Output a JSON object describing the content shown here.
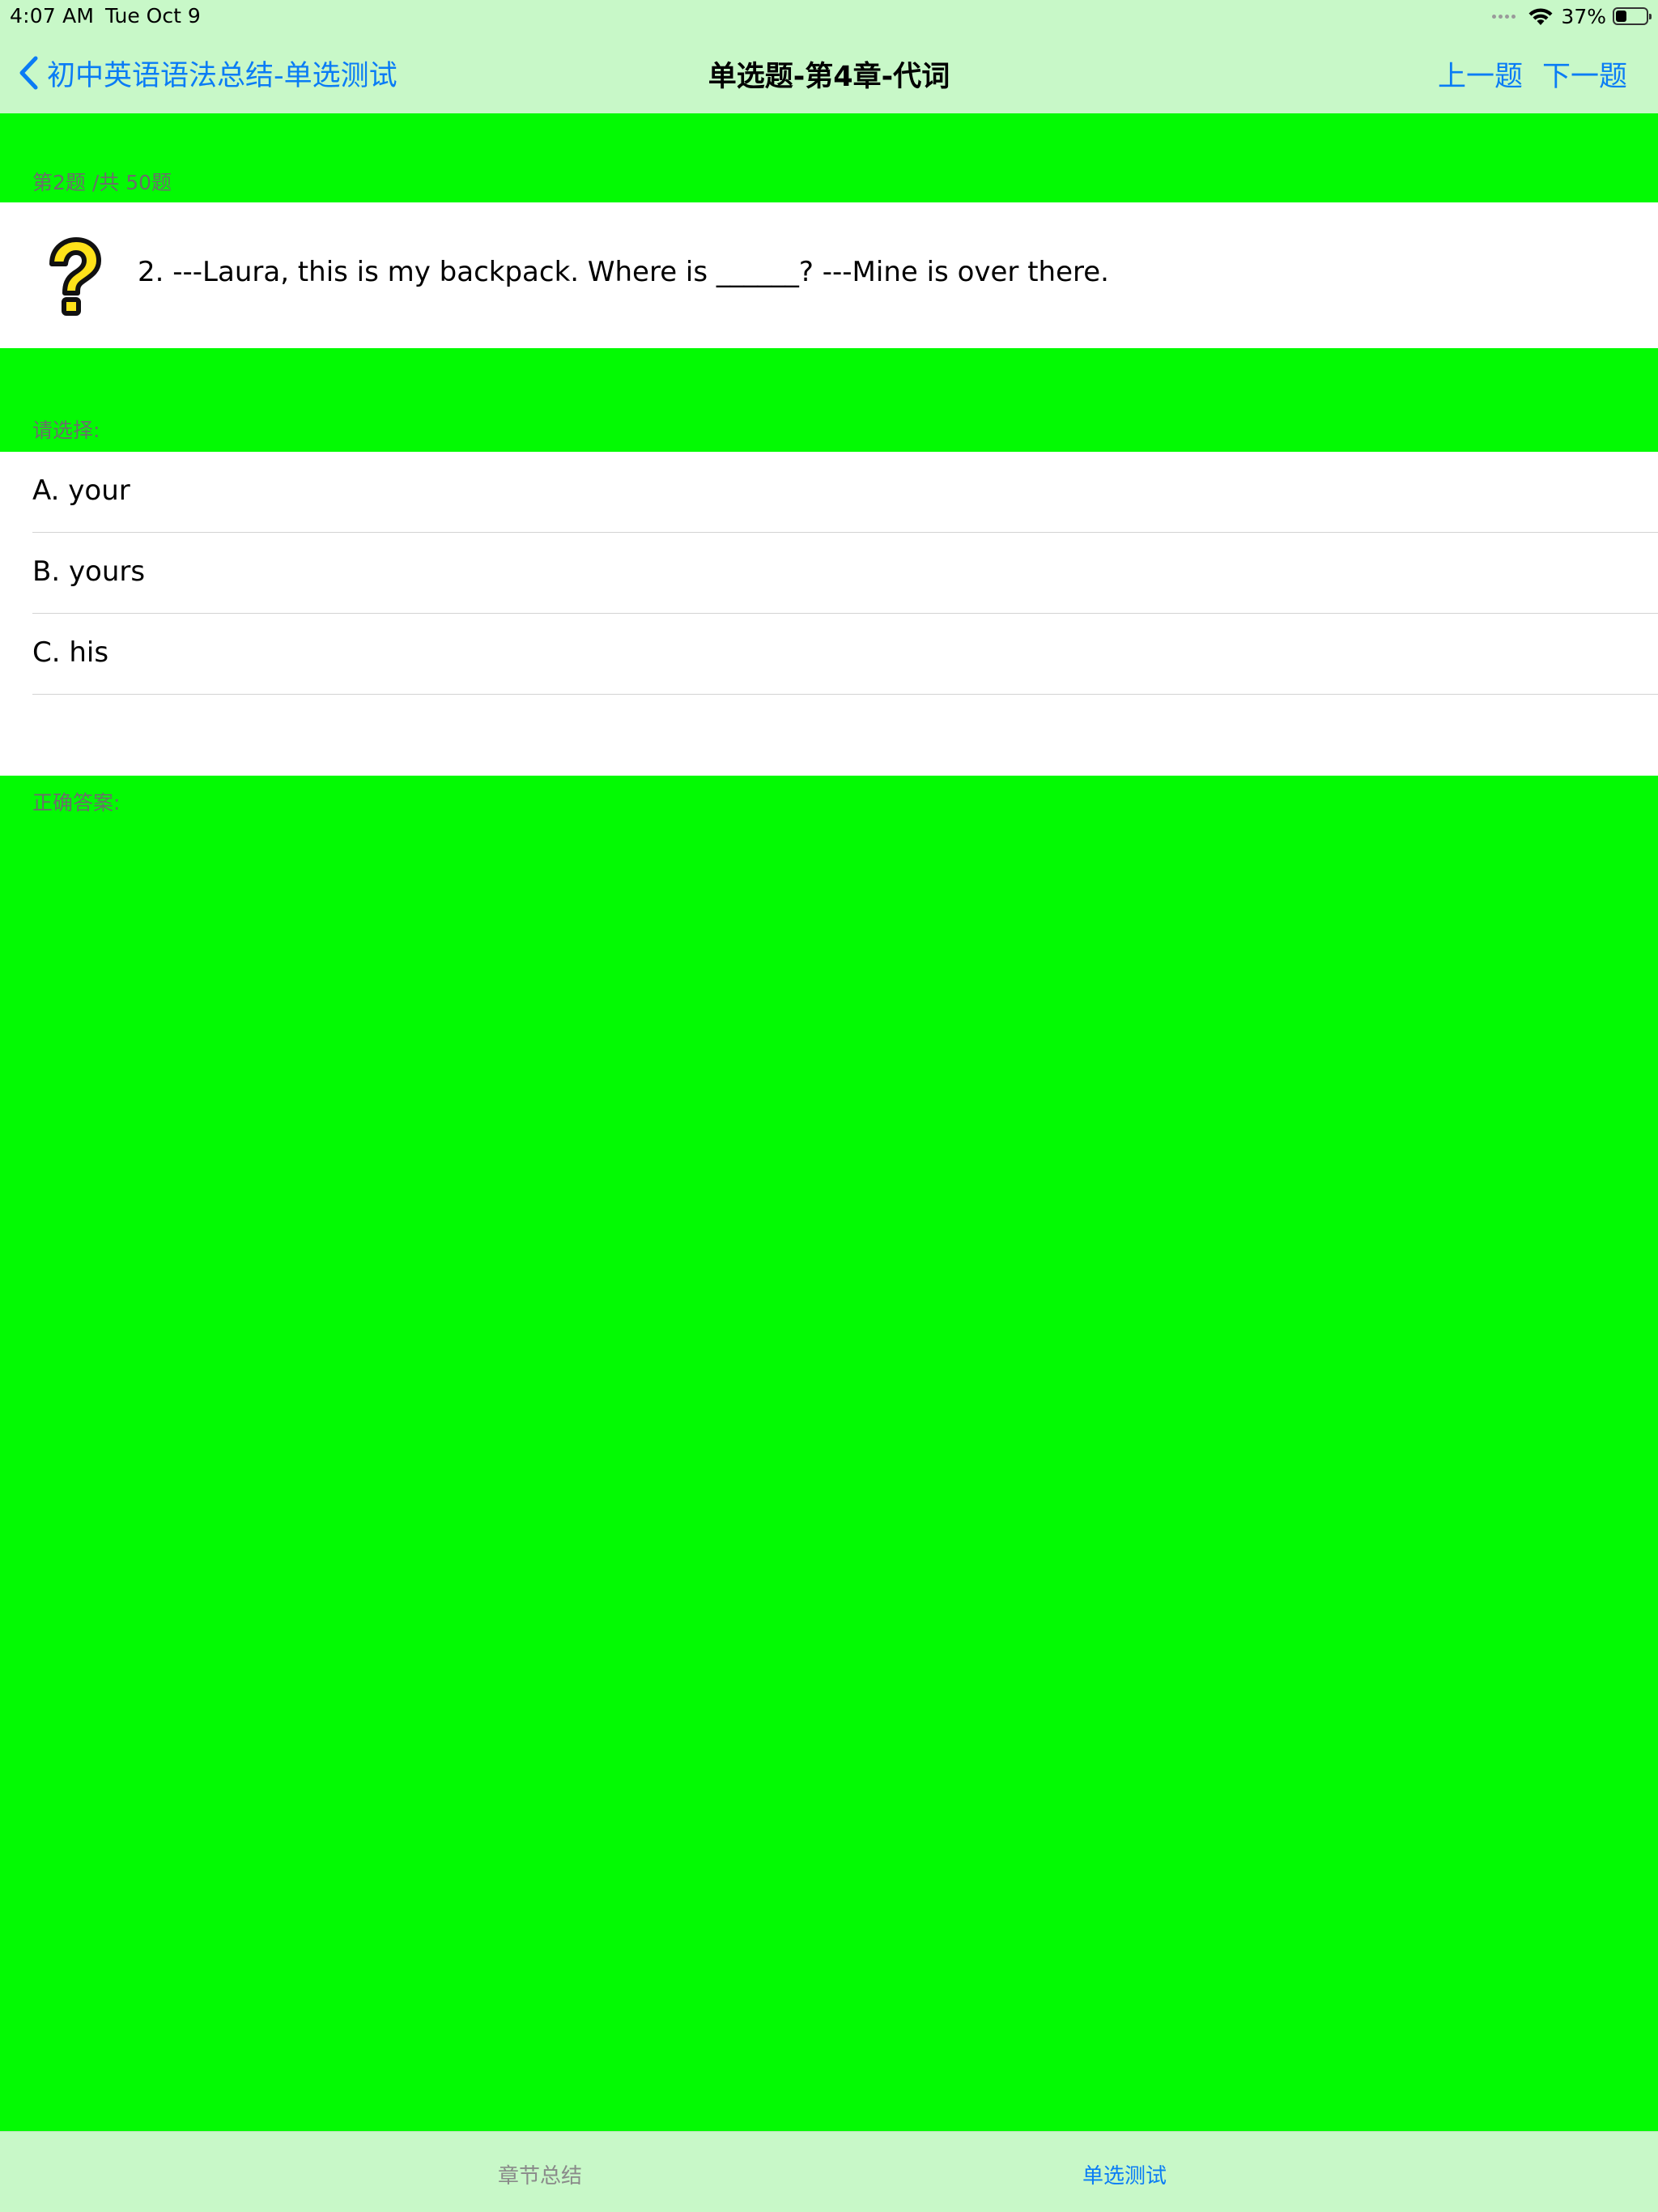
{
  "status_bar": {
    "time": "4:07 AM",
    "date": "Tue Oct 9",
    "battery_percent": "37%",
    "battery_level": 0.37,
    "icons": [
      "signal-dots-icon",
      "wifi-icon",
      "battery-icon"
    ]
  },
  "nav": {
    "back_label": "初中英语语法总结-单选测试",
    "title": "单选题-第4章-代词",
    "prev_label": "上一题",
    "next_label": "下一题"
  },
  "progress": {
    "label": "第2题 /共 50题"
  },
  "question": {
    "icon": "question-mark-icon",
    "text": "2.  ---Laura, this is my backpack. Where is ______?  ---Mine is over there."
  },
  "options_header": "请选择:",
  "options": [
    {
      "label": "A. your"
    },
    {
      "label": "B. yours"
    },
    {
      "label": "C. his"
    }
  ],
  "answer_header": "正确答案:",
  "tab_bar": {
    "tabs": [
      {
        "label": "章节总结",
        "active": false
      },
      {
        "label": "单选测试",
        "active": true
      }
    ]
  },
  "colors": {
    "content_bg": "#03fa03",
    "chrome_bg": "#c8f8c8",
    "accent": "#0a7cf5",
    "header_text": "#6c6c6c"
  }
}
